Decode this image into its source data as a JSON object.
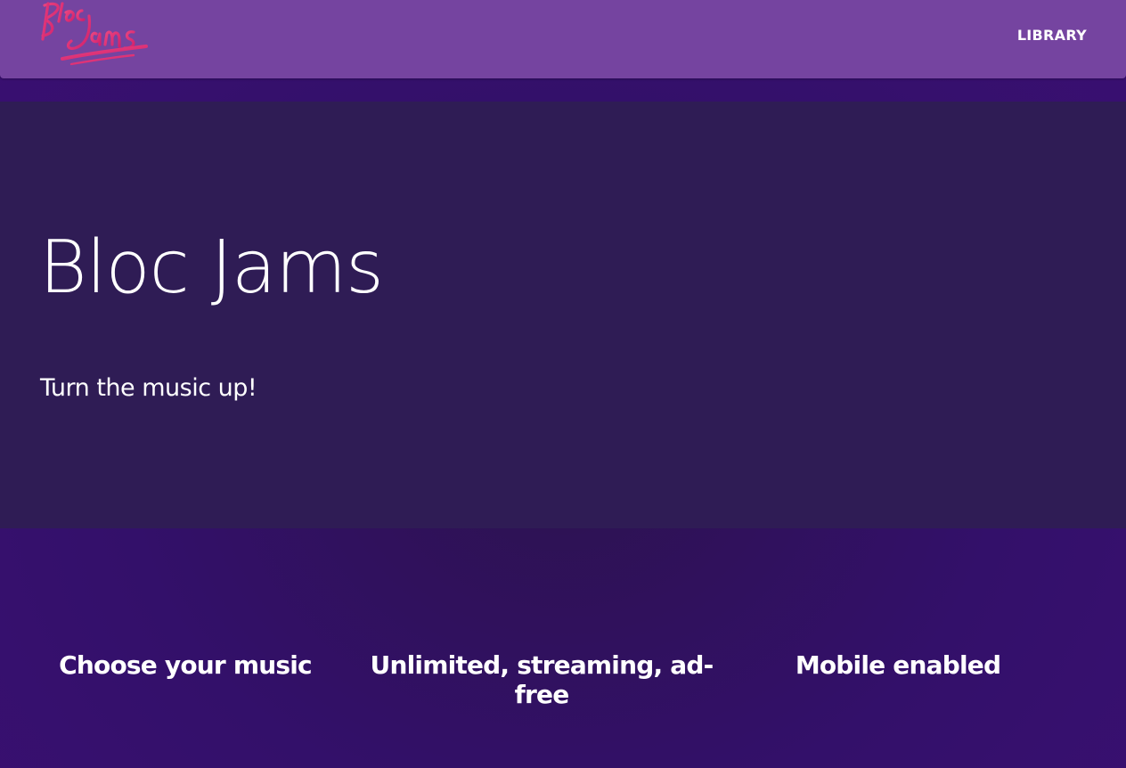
{
  "navbar": {
    "logo_alt": "Bloc Jams",
    "links": [
      {
        "label": "LIBRARY"
      }
    ]
  },
  "hero": {
    "title": "Bloc Jams",
    "tagline": "Turn the music up!"
  },
  "selling_points": [
    {
      "title": "Choose your music"
    },
    {
      "title": "Unlimited, streaming, ad-free"
    },
    {
      "title": "Mobile enabled"
    }
  ],
  "colors": {
    "navbar": "#7544a0",
    "hero_bg": "#2f1c55",
    "page_bg": "#33106a",
    "logo_pink": "#e8307a",
    "text": "#ffffff"
  }
}
